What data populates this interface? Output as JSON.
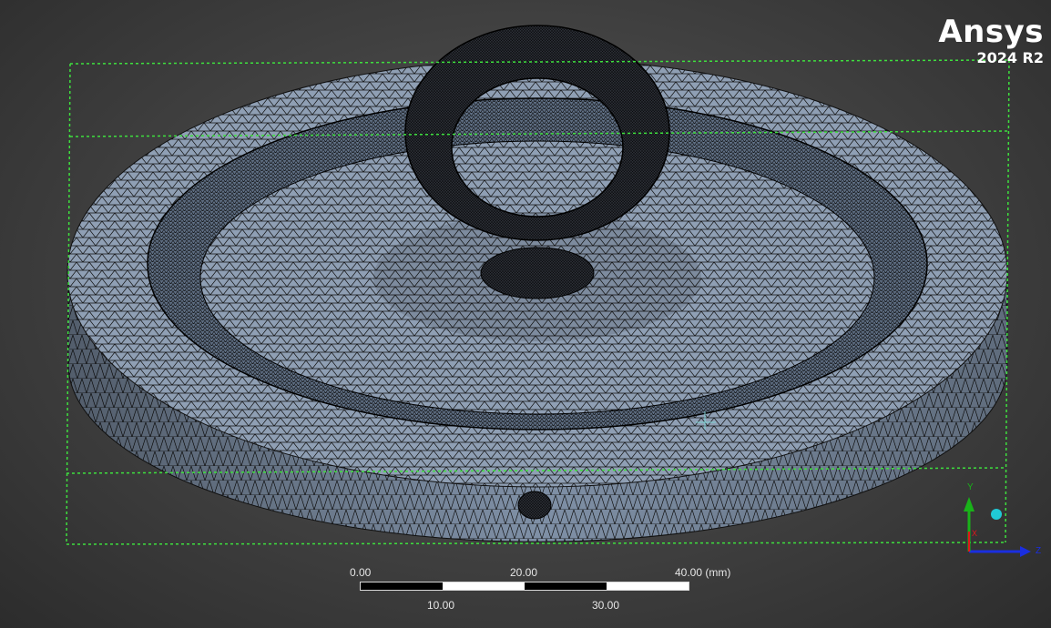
{
  "brand": {
    "name": "Ansys",
    "version": "2024 R2"
  },
  "scale": {
    "top_labels": [
      "0.00",
      "20.00",
      "40.00 (mm)"
    ],
    "bottom_labels": [
      "10.00",
      "30.00"
    ]
  },
  "triad": {
    "y": "Y",
    "z": "Z",
    "x": "X"
  },
  "colors": {
    "background": "#3c3c3c",
    "mesh_face": "#8f9fb4",
    "mesh_lines": "#0d0d0d",
    "bounding_box": "#3ee03e",
    "triad_y": "#19b219",
    "triad_z": "#1a2ee0",
    "triad_x": "#e01919",
    "triad_sphere": "#20c9d6"
  }
}
